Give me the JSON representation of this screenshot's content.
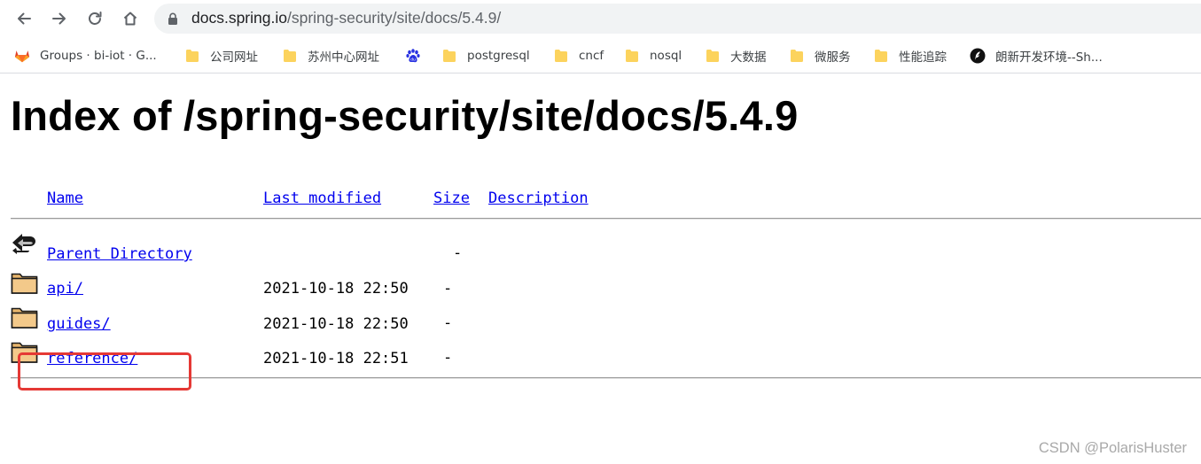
{
  "browser": {
    "url_host": "docs.spring.io",
    "url_path": "/spring-security/site/docs/5.4.9/",
    "bookmarks": [
      {
        "label": "Groups · bi-iot · G...",
        "icon": "gitlab-icon"
      },
      {
        "label": "公司网址",
        "icon": "folder-icon"
      },
      {
        "label": "苏州中心网址",
        "icon": "folder-icon"
      },
      {
        "label": "",
        "icon": "baidu-paw-icon"
      },
      {
        "label": "postgresql",
        "icon": "folder-icon"
      },
      {
        "label": "cncf",
        "icon": "folder-icon"
      },
      {
        "label": "nosql",
        "icon": "folder-icon"
      },
      {
        "label": "大数据",
        "icon": "folder-icon"
      },
      {
        "label": "微服务",
        "icon": "folder-icon"
      },
      {
        "label": "性能追踪",
        "icon": "folder-icon"
      },
      {
        "label": "朗新开发环境--Sh...",
        "icon": "feather-circle-icon"
      }
    ]
  },
  "page": {
    "title": "Index of /spring-security/site/docs/5.4.9",
    "headers": {
      "name": "Name",
      "last_modified": "Last modified",
      "size": "Size",
      "description": "Description"
    },
    "rows": [
      {
        "name": "Parent Directory",
        "modified": "",
        "size": "-",
        "icon": "back-arrow-icon"
      },
      {
        "name": "api/",
        "modified": "2021-10-18 22:50",
        "size": "-",
        "icon": "folder-icon"
      },
      {
        "name": "guides/",
        "modified": "2021-10-18 22:50",
        "size": "-",
        "icon": "folder-icon"
      },
      {
        "name": "reference/",
        "modified": "2021-10-18 22:51",
        "size": "-",
        "icon": "folder-icon"
      }
    ],
    "highlighted_row": "reference/"
  },
  "watermark": "CSDN @PolarisHuster",
  "colors": {
    "link": "#0000ee",
    "highlight": "#e53935",
    "bookmark_folder": "#fcd35d",
    "gitlab": "#e24329"
  }
}
